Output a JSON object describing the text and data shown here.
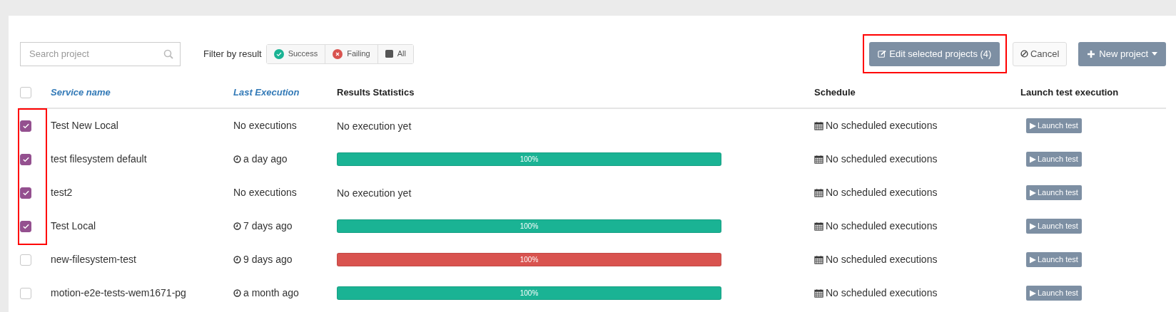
{
  "search": {
    "placeholder": "Search project"
  },
  "filter": {
    "label": "Filter by result",
    "options": [
      {
        "kind": "success",
        "label": "Success",
        "selected": false
      },
      {
        "kind": "failing",
        "label": "Failing",
        "selected": false
      },
      {
        "kind": "all",
        "label": "All",
        "selected": false
      }
    ]
  },
  "actions": {
    "edit": {
      "label": "Edit selected projects (4)",
      "highlighted": true
    },
    "cancel": {
      "label": "Cancel"
    },
    "new": {
      "label": "New project"
    }
  },
  "table": {
    "all_checked": false,
    "checked_rows_highlighted": true,
    "columns": [
      {
        "label": "Service name",
        "sortable": true
      },
      {
        "label": "Last Execution",
        "sortable": true
      },
      {
        "label": "Results Statistics",
        "sortable": false
      },
      {
        "label": "Schedule",
        "sortable": false
      },
      {
        "label": "Launch test execution",
        "sortable": false
      }
    ],
    "rows": [
      {
        "checked": true,
        "name": "Test New Local",
        "last_execution": {
          "kind": "none",
          "text": "No executions"
        },
        "result": {
          "kind": "none",
          "text": "No execution yet"
        },
        "schedule": "No scheduled executions",
        "launch": "Launch test"
      },
      {
        "checked": true,
        "name": "test filesystem default",
        "last_execution": {
          "kind": "time",
          "text": "a day ago"
        },
        "result": {
          "kind": "success",
          "level": 1,
          "text": "100%"
        },
        "schedule": "No scheduled executions",
        "launch": "Launch test"
      },
      {
        "checked": true,
        "name": "test2",
        "last_execution": {
          "kind": "none",
          "text": "No executions"
        },
        "result": {
          "kind": "none",
          "text": "No execution yet"
        },
        "schedule": "No scheduled executions",
        "launch": "Launch test"
      },
      {
        "checked": true,
        "name": "Test Local",
        "last_execution": {
          "kind": "time",
          "text": "7 days ago"
        },
        "result": {
          "kind": "success",
          "level": 1,
          "text": "100%"
        },
        "schedule": "No scheduled executions",
        "launch": "Launch test"
      },
      {
        "checked": false,
        "name": "new-filesystem-test",
        "last_execution": {
          "kind": "time",
          "text": "9 days ago"
        },
        "result": {
          "kind": "failing",
          "level": 1,
          "text": "100%"
        },
        "schedule": "No scheduled executions",
        "launch": "Launch test"
      },
      {
        "checked": false,
        "name": "motion-e2e-tests-wem1671-pg",
        "last_execution": {
          "kind": "time",
          "text": "a month ago"
        },
        "result": {
          "kind": "success",
          "level": 1,
          "text": "100%"
        },
        "schedule": "No scheduled executions",
        "launch": "Launch test"
      }
    ]
  }
}
